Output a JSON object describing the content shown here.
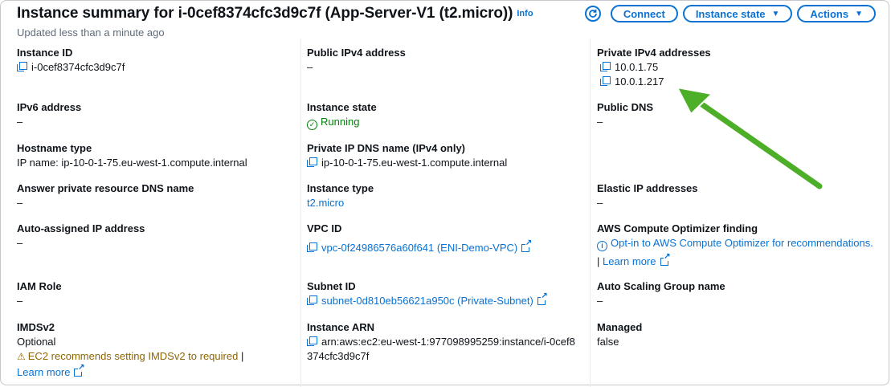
{
  "header": {
    "title": "Instance summary for i-0cef8374cfc3d9c7f (App-Server-V1 (t2.micro))",
    "info": "Info",
    "updated": "Updated less than a minute ago"
  },
  "buttons": {
    "connect": "Connect",
    "instance_state": "Instance state",
    "actions": "Actions"
  },
  "col1": {
    "instance_id": {
      "label": "Instance ID",
      "value": "i-0cef8374cfc3d9c7f"
    },
    "ipv6": {
      "label": "IPv6 address",
      "value": "–"
    },
    "hostname_type": {
      "label": "Hostname type",
      "value": "IP name: ip-10-0-1-75.eu-west-1.compute.internal"
    },
    "answer_dns": {
      "label": "Answer private resource DNS name",
      "value": "–"
    },
    "auto_ip": {
      "label": "Auto-assigned IP address",
      "value": "–"
    },
    "iam_role": {
      "label": "IAM Role",
      "value": "–"
    },
    "imdsv2": {
      "label": "IMDSv2",
      "value": "Optional",
      "warning": "EC2 recommends setting IMDSv2 to required",
      "sep": "|",
      "learn_more": "Learn more"
    }
  },
  "col2": {
    "public_ipv4": {
      "label": "Public IPv4 address",
      "value": "–"
    },
    "instance_state": {
      "label": "Instance state",
      "value": "Running"
    },
    "private_dns": {
      "label": "Private IP DNS name (IPv4 only)",
      "value": "ip-10-0-1-75.eu-west-1.compute.internal"
    },
    "instance_type": {
      "label": "Instance type",
      "value": "t2.micro"
    },
    "vpc": {
      "label": "VPC ID",
      "value": "vpc-0f24986576a60f641 (ENI-Demo-VPC)"
    },
    "subnet": {
      "label": "Subnet ID",
      "value": "subnet-0d810eb56621a950c (Private-Subnet)"
    },
    "arn": {
      "label": "Instance ARN",
      "line1": "arn:aws:ec2:eu-west-1:977098995259:instance/i-0cef8",
      "line2": "374cfc3d9c7f"
    }
  },
  "col3": {
    "private_ipv4": {
      "label": "Private IPv4 addresses",
      "values": [
        "10.0.1.75",
        "10.0.1.217"
      ]
    },
    "public_dns": {
      "label": "Public DNS",
      "value": "–"
    },
    "elastic_ip": {
      "label": "Elastic IP addresses",
      "value": "–"
    },
    "optimizer": {
      "label": "AWS Compute Optimizer finding",
      "value": "Opt-in to AWS Compute Optimizer for recommendations.",
      "sep": "|",
      "learn_more": "Learn more"
    },
    "asg": {
      "label": "Auto Scaling Group name",
      "value": "–"
    },
    "managed": {
      "label": "Managed",
      "value": "false"
    }
  },
  "colors": {
    "link": "#0972d3",
    "success": "#037f0c",
    "warning": "#8d6605",
    "annotation_arrow": "#4caf27"
  },
  "icons": [
    "refresh-icon",
    "caret-down-icon",
    "copy-icon",
    "external-link-icon",
    "check-circle-icon",
    "info-circle-icon",
    "warning-icon",
    "annotation-arrow"
  ]
}
